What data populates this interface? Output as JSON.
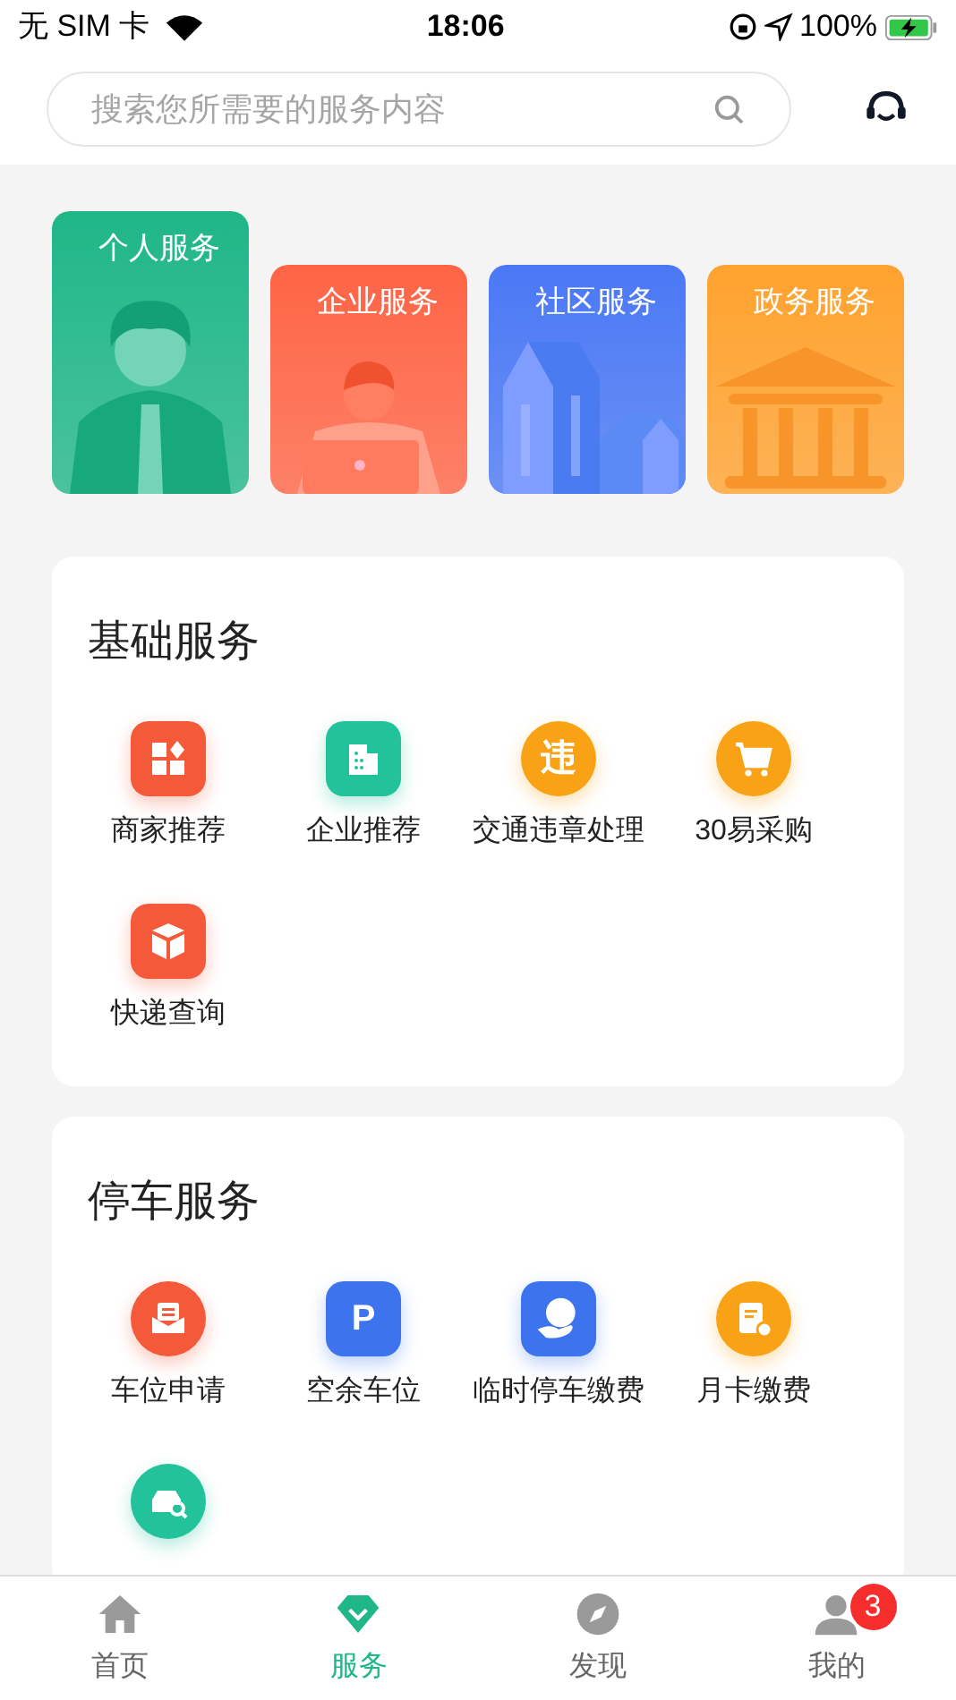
{
  "status_bar": {
    "carrier": "无 SIM 卡",
    "time": "18:06",
    "battery": "100%"
  },
  "search": {
    "placeholder": "搜索您所需要的服务内容"
  },
  "categories": [
    {
      "label": "个人服务",
      "selected": true,
      "kind": "person",
      "color": "#1fb688"
    },
    {
      "label": "企业服务",
      "selected": false,
      "kind": "laptop",
      "color": "#ff6445"
    },
    {
      "label": "社区服务",
      "selected": false,
      "kind": "city",
      "color": "#4a78f5"
    },
    {
      "label": "政务服务",
      "selected": false,
      "kind": "bank",
      "color": "#ffa22e"
    }
  ],
  "sections": [
    {
      "title": "基础服务",
      "items": [
        {
          "label": "商家推荐",
          "kind": "shop",
          "color": "#f45a3a"
        },
        {
          "label": "企业推荐",
          "kind": "building",
          "color": "#22c29a"
        },
        {
          "label": "交通违章处理",
          "kind": "violation",
          "glyph": "违",
          "color": "#f9a216"
        },
        {
          "label": "30易采购",
          "kind": "cart",
          "color": "#f9a216"
        },
        {
          "label": "快递查询",
          "kind": "box",
          "color": "#f45a3a"
        }
      ]
    },
    {
      "title": "停车服务",
      "items": [
        {
          "label": "车位申请",
          "kind": "inbox",
          "color": "#f45a3a"
        },
        {
          "label": "空余车位",
          "kind": "parking",
          "glyph": "P",
          "color": "#3d74ee"
        },
        {
          "label": "临时停车缴费",
          "kind": "coin",
          "color": "#3d74ee"
        },
        {
          "label": "月卡缴费",
          "kind": "bill",
          "color": "#f9a216"
        },
        {
          "kind": "car",
          "color": "#22c29a"
        }
      ]
    }
  ],
  "tabs": [
    {
      "label": "首页",
      "kind": "home",
      "selected": false
    },
    {
      "label": "服务",
      "kind": "gem",
      "selected": true
    },
    {
      "label": "发现",
      "kind": "compass",
      "selected": false
    },
    {
      "label": "我的",
      "kind": "user",
      "selected": false,
      "badge": "3"
    }
  ]
}
